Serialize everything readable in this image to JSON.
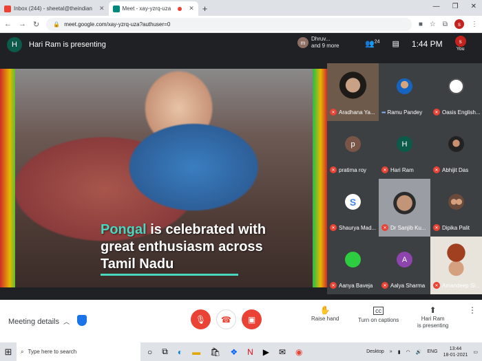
{
  "browser": {
    "tabs": [
      {
        "label": "Inbox (244) - sheetal@theindian",
        "color": "#ea4335",
        "active": false
      },
      {
        "label": "Meet - xay-yzrq-uza",
        "color": "#00897b",
        "active": true
      }
    ],
    "new_tab": "+",
    "url": "meet.google.com/xay-yzrq-uza?authuser=0",
    "profile_initial": "s"
  },
  "meet": {
    "presenter_initial": "H",
    "presenting_title": "Hari Ram is presenting",
    "others_initial": "m",
    "others_line1": "Dhruv...",
    "others_line2": "and 9 more",
    "participant_count": "24",
    "time": "1:44 PM",
    "you_initial": "s",
    "you_label": "You"
  },
  "presentation": {
    "caption_highlight": "Pongal",
    "caption_line1_rest": " is celebrated with",
    "caption_line2": "great enthusiasm across",
    "caption_line3": "Tamil Nadu"
  },
  "participants": [
    {
      "name": "Aradhana Ya...",
      "initial": "",
      "color": "#5a4a3a",
      "muted": true,
      "photo": true
    },
    {
      "name": "Ramu Pandey",
      "initial": "",
      "color": "#3c4043",
      "muted": false,
      "photo": false,
      "speaking": true
    },
    {
      "name": "Oasis English...",
      "initial": "",
      "color": "#ffffff",
      "muted": true,
      "photo": false
    },
    {
      "name": "pratima roy",
      "initial": "p",
      "color": "#795548",
      "muted": true,
      "photo": false
    },
    {
      "name": "Hari Ram",
      "initial": "H",
      "color": "#0b5a4a",
      "muted": true,
      "photo": false
    },
    {
      "name": "Abhijit Das",
      "initial": "",
      "color": "#3c4043",
      "muted": true,
      "photo": false
    },
    {
      "name": "Shaurya Mad...",
      "initial": "S",
      "color": "#ffffff",
      "muted": true,
      "photo": false
    },
    {
      "name": "Dr Sanjib Ku...",
      "initial": "",
      "color": "#6b6f75",
      "muted": true,
      "photo": true
    },
    {
      "name": "Dipika Palit",
      "initial": "",
      "color": "#3c4043",
      "muted": true,
      "photo": false
    },
    {
      "name": "Aanya Baveja",
      "initial": "",
      "color": "#2ecc40",
      "muted": true,
      "photo": false
    },
    {
      "name": "Aalya Sharma",
      "initial": "A",
      "color": "#8e44ad",
      "muted": true,
      "photo": false
    },
    {
      "name": "Amandeep Si...",
      "initial": "",
      "color": "#8a8070",
      "muted": true,
      "photo": true
    }
  ],
  "controls": {
    "meeting_details": "Meeting details",
    "raise_hand": "Raise hand",
    "captions": "Turn on captions",
    "presenting_line1": "Hari Ram",
    "presenting_line2": "is presenting"
  },
  "taskbar": {
    "search_placeholder": "Type here to search",
    "desktop": "Desktop",
    "lang": "ENG",
    "time": "13:44",
    "date": "18-01-2021"
  }
}
